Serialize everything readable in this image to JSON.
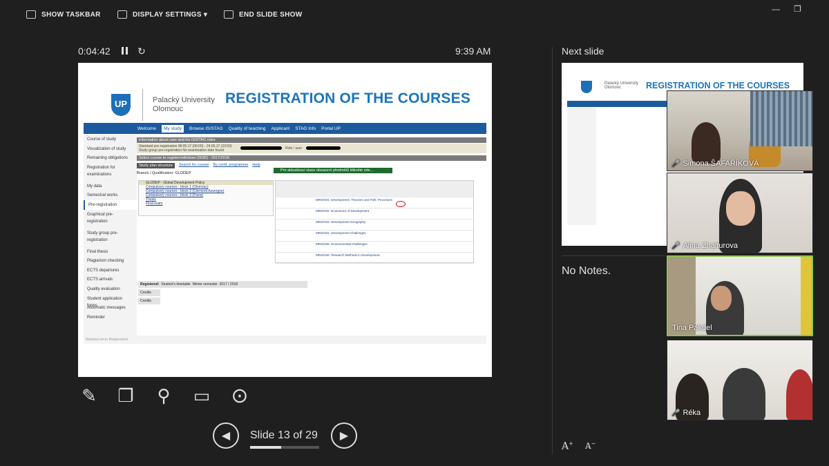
{
  "topbar": {
    "show_taskbar": "SHOW TASKBAR",
    "display_settings": "DISPLAY SETTINGS ▾",
    "end_slide_show": "END SLIDE SHOW"
  },
  "presenter": {
    "timer": "0:04:42",
    "clock": "9:39 AM",
    "slide_counter": "Slide 13 of 29",
    "progress": 0.448,
    "next_slide_label": "Next slide",
    "notes": "No Notes.",
    "font_increase": "A",
    "font_decrease": "A"
  },
  "slide": {
    "university": "Palacký University Olomouc",
    "title": "REGISTRATION OF THE COURSES",
    "nav": [
      "Welcome",
      "My study",
      "Browse IS/STAG",
      "Quality of teaching",
      "Applicant",
      "STAG Info",
      "Portal UP"
    ],
    "sidebar": [
      "Course of study",
      "Visualization of study",
      "Remaining obligations",
      "Registration for examinations",
      "My data",
      "Semestral works",
      "Pre-registration",
      "Graphical pre-registration",
      "Study group pre-registration",
      "Final thesis",
      "Plagiarism checking",
      "ECTS departures",
      "ECTS arrivals",
      "Quality evaluation",
      "Student application forms",
      "Automatic messages",
      "Reminder"
    ],
    "info_bar": "Information about user and his IS/STAG roles",
    "info_line1": "Standard pre-registration 08.05.17 (00:00) - 24.05.17 (23:59)",
    "info_line2": "Study group pre-registration No examination date found",
    "role_label": "Role / user",
    "select_bar": "Select course to register/withdraw (5030) - 2017/2018",
    "tabs": [
      "Study plan structure",
      "Search for course",
      "By certif. programme",
      "Help"
    ],
    "green_bar": "Pro aktualizaci stavu obsazení předmětů klikněte zde...",
    "branch": "Branch / Qualification: GLODEP",
    "course_header": "GLODEP - Global Development Policy",
    "course_blocks": [
      "Compulsory courses - block 1 (Olomouc)",
      "Compulsory courses - block 2 (Clermont Auvergne)",
      "Compulsory courses - block 3 (Pavia)",
      "Thesis",
      "Final exam"
    ],
    "courses": [
      {
        "code": "MRS/G01",
        "name": "Development, Theories and Polit. Processes"
      },
      {
        "code": "MRS/G02",
        "name": "Economics of Development"
      },
      {
        "code": "MRS/G03",
        "name": "Development Geography"
      },
      {
        "code": "MRS/G04",
        "name": "Development Challenges"
      },
      {
        "code": "MRS/G05",
        "name": "Environmental Challenges"
      },
      {
        "code": "MRS/G06",
        "name": "Research Methods in Development"
      }
    ],
    "registered_label": "Registered:",
    "timetable_label": "Student's timetable",
    "semester": "Winter semester",
    "year": "2017 / 2018",
    "credits_label": "Credits",
    "footer": "Klasická verze Responzivní"
  },
  "participants": [
    {
      "name": "Simona ŠAFAŘÍKOVÁ",
      "muted": true
    },
    {
      "name": "Alina Zhalturova",
      "muted": true
    },
    {
      "name": "Tina Pakdel",
      "muted": false
    },
    {
      "name": "Réka",
      "muted": true
    }
  ],
  "colors": {
    "background": "#1f1f1f",
    "slide_title": "#1b75bb",
    "nav_blue": "#1c5a9e",
    "active_speaker": "#8bc34a",
    "mute_red": "#e53935"
  }
}
